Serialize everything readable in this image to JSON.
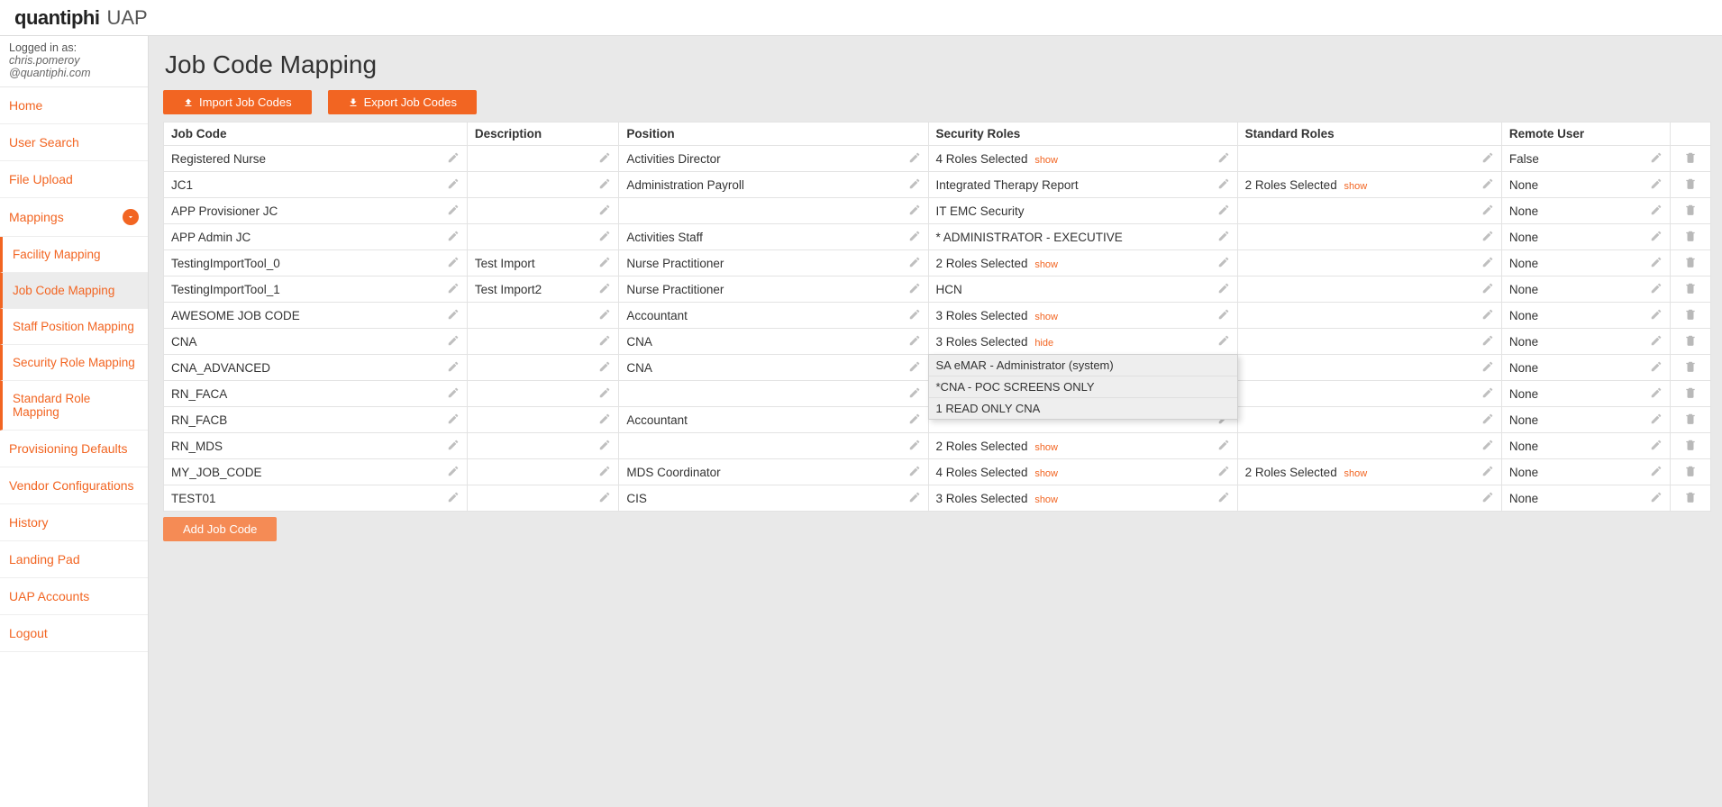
{
  "brand": {
    "name": "quantiphi",
    "suffix": "UAP"
  },
  "logged_in": {
    "prefix": "Logged in as:",
    "user": "chris.pomeroy @quantiphi.com"
  },
  "sidebar": {
    "items": [
      {
        "label": "Home",
        "name": "home"
      },
      {
        "label": "User Search",
        "name": "user-search"
      },
      {
        "label": "File Upload",
        "name": "file-upload"
      },
      {
        "label": "Mappings",
        "name": "mappings",
        "expandable": true,
        "expanded": true
      },
      {
        "label": "Provisioning Defaults",
        "name": "provisioning-defaults"
      },
      {
        "label": "Vendor Configurations",
        "name": "vendor-configurations"
      },
      {
        "label": "History",
        "name": "history"
      },
      {
        "label": "Landing Pad",
        "name": "landing-pad"
      },
      {
        "label": "UAP Accounts",
        "name": "uap-accounts"
      },
      {
        "label": "Logout",
        "name": "logout"
      }
    ],
    "sub_items": [
      {
        "label": "Facility Mapping",
        "name": "facility-mapping"
      },
      {
        "label": "Job Code Mapping",
        "name": "job-code-mapping",
        "active": true
      },
      {
        "label": "Staff Position Mapping",
        "name": "staff-position-mapping"
      },
      {
        "label": "Security Role Mapping",
        "name": "security-role-mapping"
      },
      {
        "label": "Standard Role Mapping",
        "name": "standard-role-mapping"
      }
    ]
  },
  "page": {
    "title": "Job Code Mapping",
    "import_btn": "Import Job Codes",
    "export_btn": "Export Job Codes",
    "add_btn": "Add Job Code"
  },
  "columns": {
    "job_code": "Job Code",
    "description": "Description",
    "position": "Position",
    "security_roles": "Security Roles",
    "standard_roles": "Standard Roles",
    "remote_user": "Remote User"
  },
  "links": {
    "show": "show",
    "hide": "hide"
  },
  "popup_roles": [
    "SA eMAR - Administrator (system)",
    "*CNA - POC SCREENS ONLY",
    "1 READ ONLY CNA"
  ],
  "rows": [
    {
      "job": "Registered Nurse",
      "desc": "",
      "pos": "Activities Director",
      "sec": "4 Roles Selected",
      "sec_link": "show",
      "std": "",
      "rem": "False"
    },
    {
      "job": "JC1",
      "desc": "",
      "pos": "Administration Payroll",
      "sec": "Integrated Therapy Report",
      "std": "2 Roles Selected",
      "std_link": "show",
      "rem": "None"
    },
    {
      "job": "APP Provisioner JC",
      "desc": "",
      "pos": "",
      "sec": "IT EMC Security",
      "std": "",
      "rem": "None"
    },
    {
      "job": "APP Admin JC",
      "desc": "",
      "pos": "Activities Staff",
      "sec": "* ADMINISTRATOR - EXECUTIVE",
      "std": "",
      "rem": "None"
    },
    {
      "job": "TestingImportTool_0",
      "desc": "Test Import",
      "pos": "Nurse Practitioner",
      "sec": "2 Roles Selected",
      "sec_link": "show",
      "std": "",
      "rem": "None"
    },
    {
      "job": "TestingImportTool_1",
      "desc": "Test Import2",
      "pos": "Nurse Practitioner",
      "sec": "HCN",
      "std": "",
      "rem": "None"
    },
    {
      "job": "AWESOME JOB CODE",
      "desc": "",
      "pos": "Accountant",
      "sec": "3 Roles Selected",
      "sec_link": "show",
      "std": "",
      "rem": "None"
    },
    {
      "job": "CNA",
      "desc": "",
      "pos": "CNA",
      "sec": "3 Roles Selected",
      "sec_link": "hide",
      "popup": true,
      "std": "",
      "rem": "None"
    },
    {
      "job": "CNA_ADVANCED",
      "desc": "",
      "pos": "CNA",
      "sec": "",
      "std": "",
      "rem": "None"
    },
    {
      "job": "RN_FACA",
      "desc": "",
      "pos": "",
      "sec": "",
      "std": "",
      "rem": "None"
    },
    {
      "job": "RN_FACB",
      "desc": "",
      "pos": "Accountant",
      "sec": "",
      "std": "",
      "rem": "None"
    },
    {
      "job": "RN_MDS",
      "desc": "",
      "pos": "",
      "sec": "2 Roles Selected",
      "sec_link": "show",
      "std": "",
      "rem": "None"
    },
    {
      "job": "MY_JOB_CODE",
      "desc": "",
      "pos": "MDS Coordinator",
      "sec": "4 Roles Selected",
      "sec_link": "show",
      "std": "2 Roles Selected",
      "std_link": "show",
      "rem": "None"
    },
    {
      "job": "TEST01",
      "desc": "",
      "pos": "CIS",
      "sec": "3 Roles Selected",
      "sec_link": "show",
      "std": "",
      "rem": "None"
    }
  ]
}
